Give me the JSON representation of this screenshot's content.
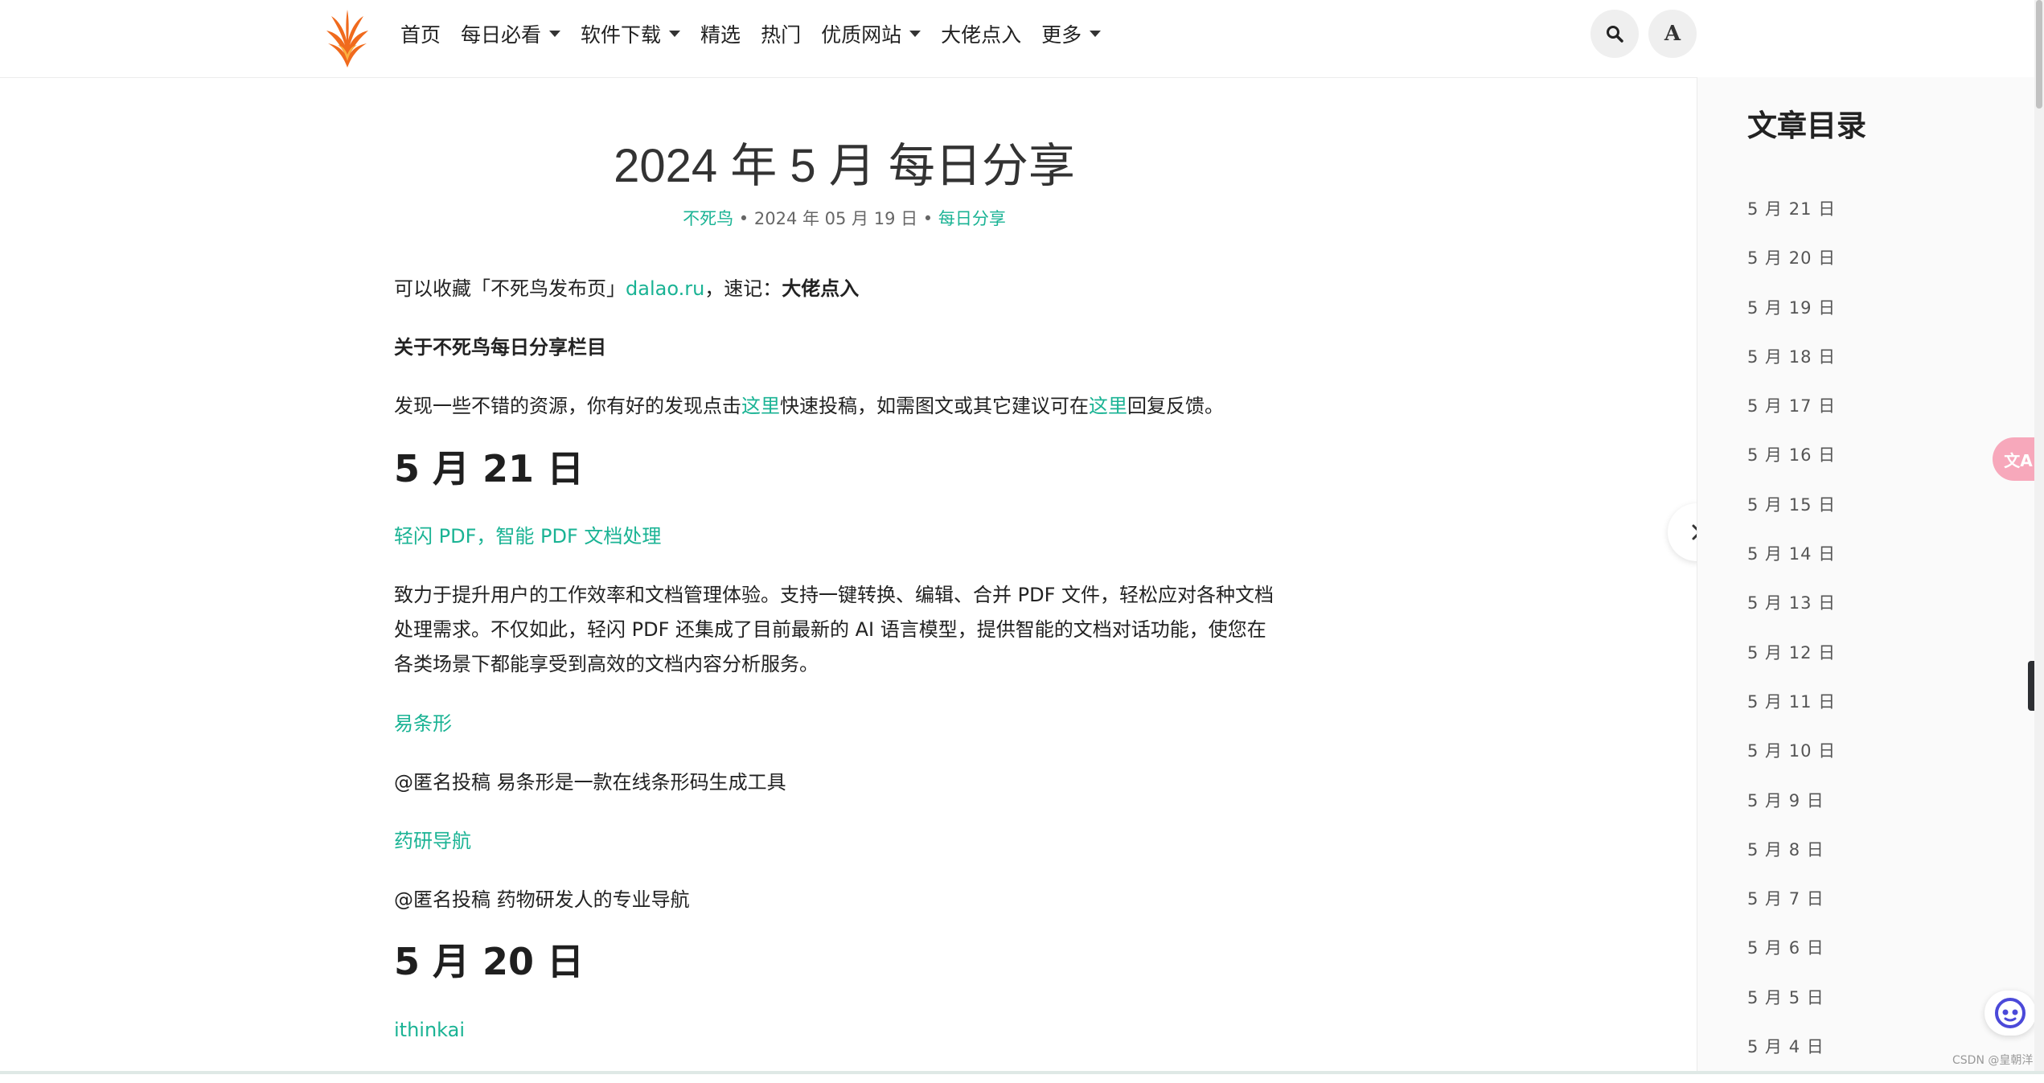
{
  "header": {
    "nav": [
      {
        "label": "首页",
        "dropdown": false
      },
      {
        "label": "每日必看",
        "dropdown": true
      },
      {
        "label": "软件下载",
        "dropdown": true
      },
      {
        "label": "精选",
        "dropdown": false
      },
      {
        "label": "热门",
        "dropdown": false
      },
      {
        "label": "优质网站",
        "dropdown": true
      },
      {
        "label": "大佬点入",
        "dropdown": false
      },
      {
        "label": "更多",
        "dropdown": true
      }
    ],
    "font_button_label": "A",
    "icons": {
      "search": "search-icon",
      "logo": "phoenix-logo-icon"
    }
  },
  "article": {
    "title": "2024 年 5 月 每日分享",
    "meta": {
      "author": "不死鸟",
      "sep1": " • ",
      "date": "2024 年 05 月 19 日",
      "sep2": " • ",
      "category": "每日分享"
    },
    "intro": {
      "prefix": "可以收藏「不死鸟发布页」",
      "link": "dalao.ru",
      "middle": "，速记：",
      "bold": "大佬点入"
    },
    "about_heading": "关于不死鸟每日分享栏目",
    "about": {
      "part1": "发现一些不错的资源，你有好的发现点击",
      "link1": "这里",
      "part2": "快速投稿，如需图文或其它建议可在",
      "link2": "这里",
      "part3": "回复反馈。"
    },
    "sections": [
      {
        "heading": "5 月 21 日",
        "items": [
          {
            "link": "轻闪 PDF，智能 PDF 文档处理",
            "desc_lines": [
              "致力于提升用户的工作效率和文档管理体验。支持一键转换、编辑、合并 PDF 文件，轻松应对各种文档",
              "处理需求。不仅如此，轻闪 PDF 还集成了目前最新的 AI 语言模型，提供智能的文档对话功能，使您在",
              "各类场景下都能享受到高效的文档内容分析服务。"
            ]
          },
          {
            "link": "易条形",
            "desc_lines": [
              "@匿名投稿 易条形是一款在线条形码生成工具"
            ]
          },
          {
            "link": "药研导航",
            "desc_lines": [
              "@匿名投稿 药物研发人的专业导航"
            ]
          }
        ]
      },
      {
        "heading": "5 月 20 日",
        "items": [
          {
            "link": "ithinkai",
            "desc_lines": []
          }
        ]
      }
    ]
  },
  "toc": {
    "title": "文章目录",
    "items": [
      "5 月 21 日",
      "5 月 20 日",
      "5 月 19 日",
      "5 月 18 日",
      "5 月 17 日",
      "5 月 16 日",
      "5 月 15 日",
      "5 月 14 日",
      "5 月 13 日",
      "5 月 12 日",
      "5 月 11 日",
      "5 月 10 日",
      "5 月 9 日",
      "5 月 8 日",
      "5 月 7 日",
      "5 月 6 日",
      "5 月 5 日",
      "5 月 4 日"
    ]
  },
  "floating": {
    "translate_label": "文A",
    "watermark": "CSDN @皇朝洋"
  },
  "colors": {
    "accent": "#1ab394",
    "translate": "#f7a8bb",
    "assistant": "#4b49d9"
  }
}
